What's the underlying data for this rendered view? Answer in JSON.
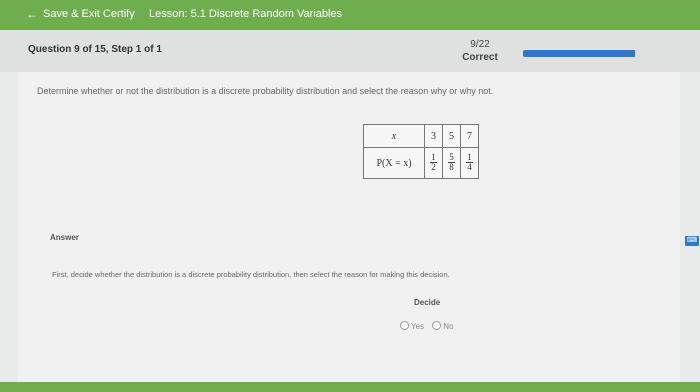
{
  "topbar": {
    "back_icon": "arrow-left-icon",
    "exit_label": "Save & Exit Certify",
    "lesson_label": "Lesson: 5.1 Discrete Random Variables"
  },
  "header": {
    "question_label": "Question 9 of 15, Step 1 of 1",
    "score": "9/22",
    "result": "Correct",
    "progress_fraction": 0.99
  },
  "main": {
    "prompt": "Determine whether or not the distribution is a discrete probability distribution and select the reason why or why not.",
    "table": {
      "x_header": "x",
      "x_values": [
        "3",
        "5",
        "7"
      ],
      "p_header": "P(X = x)",
      "p_values": [
        {
          "num": "1",
          "den": "2"
        },
        {
          "num": "5",
          "den": "8"
        },
        {
          "num": "1",
          "den": "4"
        }
      ]
    },
    "answer_label": "Answer",
    "help_icon": "keyboard-icon",
    "help_label": "⌨",
    "instruction": "First, decide whether the distribution is a discrete probability distribution, then select the reason for making this decision.",
    "decide_label": "Decide",
    "options": [
      "Yes",
      "No"
    ]
  },
  "colors": {
    "topbar": "#6fae4f",
    "progress": "#2f78c4"
  }
}
